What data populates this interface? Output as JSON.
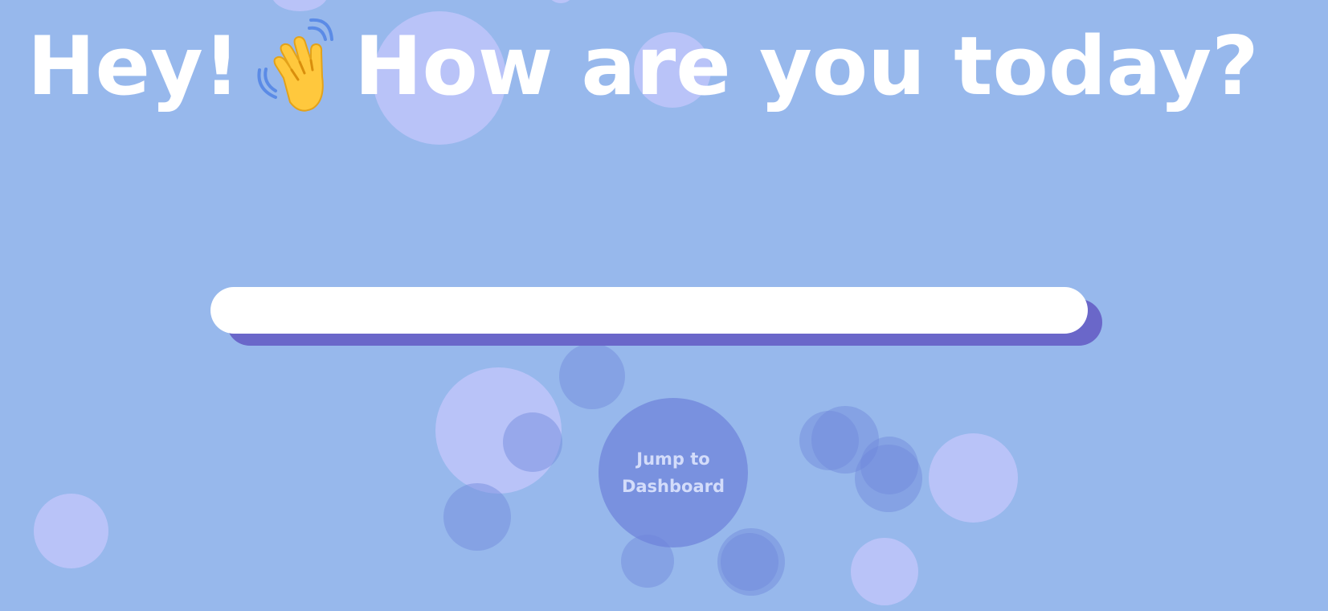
{
  "colors": {
    "background": "#97b8ec",
    "headline_text": "#ffffff",
    "input_background": "#ffffff",
    "input_shadow": "#6a67c9",
    "bubble_light": "#bec4fa",
    "bubble_dark": "#6e87dc",
    "button_background": "#6e82da",
    "button_text": "#d3dcfa"
  },
  "header": {
    "greeting": "Hey!",
    "wave_icon": "waving-hand-emoji",
    "question": "How are you today?"
  },
  "mood_input": {
    "value": "",
    "placeholder": ""
  },
  "jump_button": {
    "line1": "Jump to",
    "line2": "Dashboard"
  }
}
